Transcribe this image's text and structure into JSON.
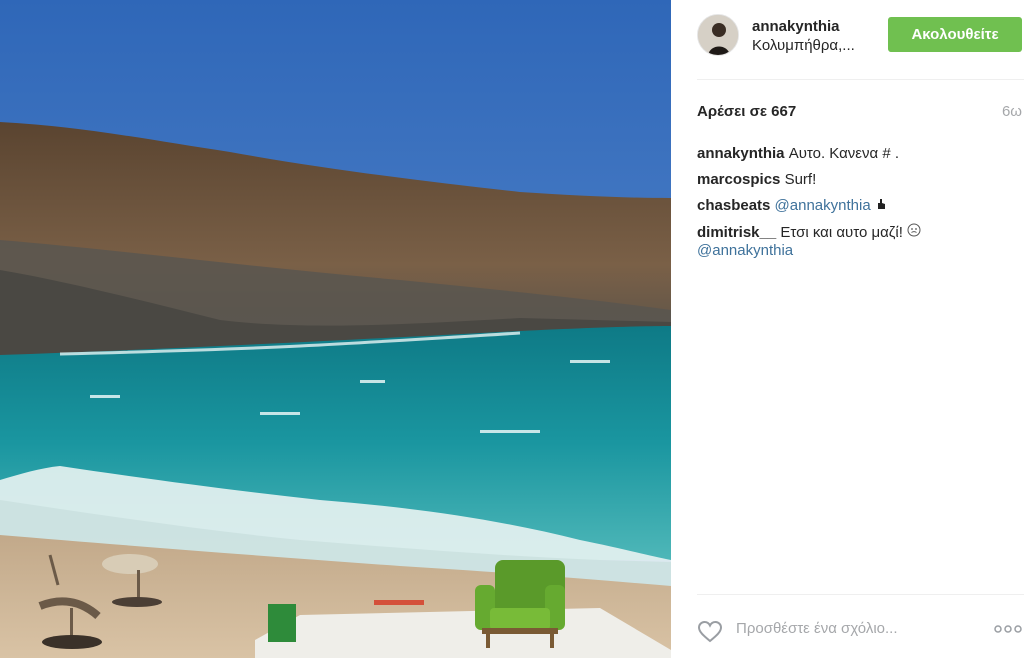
{
  "post": {
    "username": "annakynthia",
    "location": "Κολυμπήθρα,...",
    "follow_label": "Ακολουθείτε",
    "likes_text": "Αρέσει σε 667",
    "time_ago": "6ω",
    "comment_placeholder": "Προσθέστε ένα σχόλιο...",
    "comments": [
      {
        "user": "annakynthia",
        "text": "Αυτο. Κανενα # ."
      },
      {
        "user": "marcospics",
        "text": "Surf!"
      },
      {
        "user": "chasbeats",
        "mention": "@annakynthia",
        "emoji": "pointing-hand"
      },
      {
        "user": "dimitrisk__",
        "text": "Ετσι και αυτο μαζί!",
        "emoji": "face",
        "mention": "@annakynthia"
      }
    ]
  },
  "colors": {
    "follow_green": "#70c050",
    "mention_blue": "#3f729b",
    "muted": "#a5a7aa"
  },
  "icons": {
    "like": "heart-icon",
    "options": "more-options-icon"
  }
}
